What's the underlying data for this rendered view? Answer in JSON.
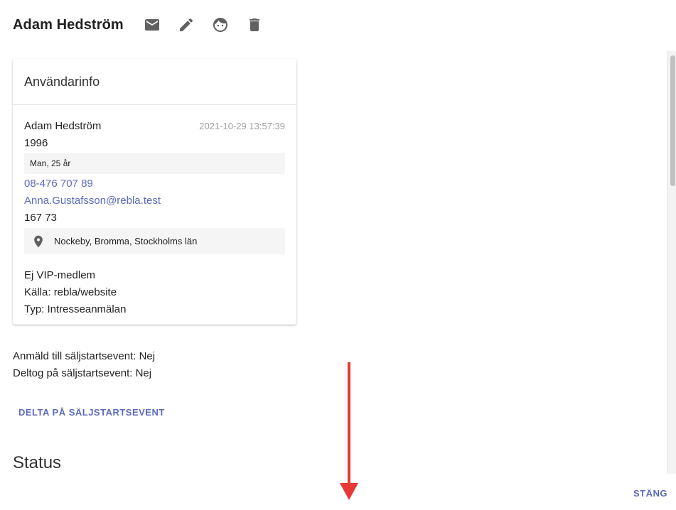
{
  "header": {
    "name": "Adam Hedström",
    "icons": [
      "mail-icon",
      "edit-icon",
      "face-icon",
      "delete-icon"
    ]
  },
  "card": {
    "title": "Användarinfo",
    "name": "Adam Hedström",
    "timestamp": "2021-10-29 13:57:39",
    "birth_year": "1996",
    "gender_age": "Man, 25 år",
    "phone": "08-476 707 89",
    "email": "Anna.Gustafsson@rebla.test",
    "postal_code": "167 73",
    "location": "Nockeby, Bromma, Stockholms län",
    "vip": "Ej VIP-medlem",
    "source": "Källa: rebla/website",
    "type": "Typ: Intresseanmälan"
  },
  "events": {
    "registered": "Anmäld till säljstartsevent: Nej",
    "attended": "Deltog på säljstartsevent: Nej",
    "action_label": "DELTA PÅ SÄLJSTARTSEVENT"
  },
  "status_heading": "Status",
  "close_label": "STÄNG",
  "colors": {
    "link": "#5c6bc0",
    "icon": "#616161",
    "annotation_arrow": "#e53935"
  }
}
